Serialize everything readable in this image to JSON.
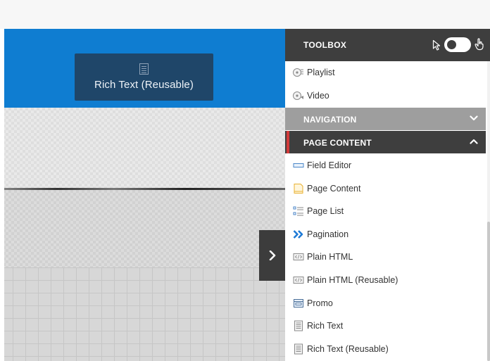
{
  "drag_preview": {
    "label": "Rich Text (Reusable)",
    "icon": "rich-text-icon"
  },
  "toolbox": {
    "title": "TOOLBOX",
    "icons": [
      "cursor-arrow-icon",
      "mode-toggle",
      "hand-pointer-icon"
    ],
    "items_top": [
      {
        "label": "Playlist",
        "icon": "playlist-icon"
      },
      {
        "label": "Video",
        "icon": "video-icon"
      }
    ],
    "categories": {
      "navigation": {
        "label": "NAVIGATION",
        "state": "collapsed"
      },
      "page_content": {
        "label": "PAGE CONTENT",
        "state": "expanded"
      }
    },
    "page_content_items": [
      {
        "label": "Field Editor",
        "icon": "field-editor-icon"
      },
      {
        "label": "Page Content",
        "icon": "page-content-icon"
      },
      {
        "label": "Page List",
        "icon": "page-list-icon"
      },
      {
        "label": "Pagination",
        "icon": "pagination-icon"
      },
      {
        "label": "Plain HTML",
        "icon": "html-icon"
      },
      {
        "label": "Plain HTML (Reusable)",
        "icon": "html-icon"
      },
      {
        "label": "Promo",
        "icon": "promo-icon"
      },
      {
        "label": "Rich Text",
        "icon": "rich-text-icon"
      },
      {
        "label": "Rich Text (Reusable)",
        "icon": "rich-text-icon"
      }
    ]
  },
  "colors": {
    "banner_blue": "#0f7dd1",
    "toolbox_header": "#3e3e3e",
    "category_collapsed": "#9e9e9e",
    "category_accent": "#d23a3a",
    "pagination_chevron": "#1e7ad6"
  }
}
